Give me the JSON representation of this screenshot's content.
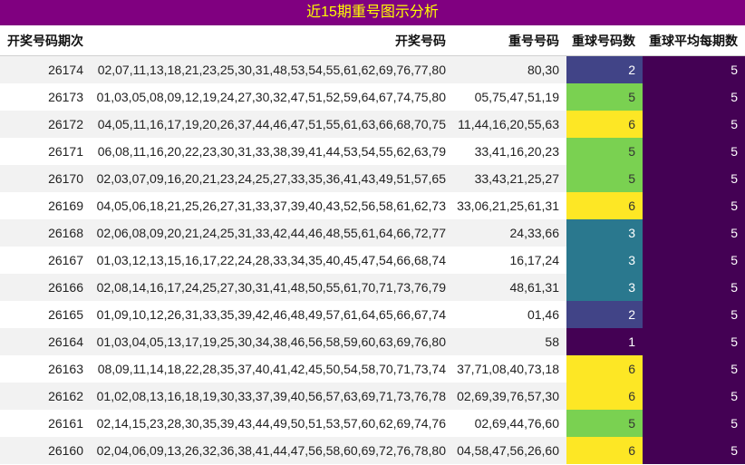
{
  "title": "近15期重号图示分析",
  "chart_data": {
    "type": "table",
    "title": "近15期重号图示分析",
    "columns": [
      "开奖号码期次",
      "开奖号码",
      "重号号码",
      "重球号码数",
      "重球平均每期数"
    ],
    "rows": [
      {
        "period": "26174",
        "numbers": "02,07,11,13,18,21,23,25,30,31,48,53,54,55,61,62,69,76,77,80",
        "repeats": "80,30",
        "repeat_count": 2,
        "avg": 5
      },
      {
        "period": "26173",
        "numbers": "01,03,05,08,09,12,19,24,27,30,32,47,51,52,59,64,67,74,75,80",
        "repeats": "05,75,47,51,19",
        "repeat_count": 5,
        "avg": 5
      },
      {
        "period": "26172",
        "numbers": "04,05,11,16,17,19,20,26,37,44,46,47,51,55,61,63,66,68,70,75",
        "repeats": "11,44,16,20,55,63",
        "repeat_count": 6,
        "avg": 5
      },
      {
        "period": "26171",
        "numbers": "06,08,11,16,20,22,23,30,31,33,38,39,41,44,53,54,55,62,63,79",
        "repeats": "33,41,16,20,23",
        "repeat_count": 5,
        "avg": 5
      },
      {
        "period": "26170",
        "numbers": "02,03,07,09,16,20,21,23,24,25,27,33,35,36,41,43,49,51,57,65",
        "repeats": "33,43,21,25,27",
        "repeat_count": 5,
        "avg": 5
      },
      {
        "period": "26169",
        "numbers": "04,05,06,18,21,25,26,27,31,33,37,39,40,43,52,56,58,61,62,73",
        "repeats": "33,06,21,25,61,31",
        "repeat_count": 6,
        "avg": 5
      },
      {
        "period": "26168",
        "numbers": "02,06,08,09,20,21,24,25,31,33,42,44,46,48,55,61,64,66,72,77",
        "repeats": "24,33,66",
        "repeat_count": 3,
        "avg": 5
      },
      {
        "period": "26167",
        "numbers": "01,03,12,13,15,16,17,22,24,28,33,34,35,40,45,47,54,66,68,74",
        "repeats": "16,17,24",
        "repeat_count": 3,
        "avg": 5
      },
      {
        "period": "26166",
        "numbers": "02,08,14,16,17,24,25,27,30,31,41,48,50,55,61,70,71,73,76,79",
        "repeats": "48,61,31",
        "repeat_count": 3,
        "avg": 5
      },
      {
        "period": "26165",
        "numbers": "01,09,10,12,26,31,33,35,39,42,46,48,49,57,61,64,65,66,67,74",
        "repeats": "01,46",
        "repeat_count": 2,
        "avg": 5
      },
      {
        "period": "26164",
        "numbers": "01,03,04,05,13,17,19,25,30,34,38,46,56,58,59,60,63,69,76,80",
        "repeats": "58",
        "repeat_count": 1,
        "avg": 5
      },
      {
        "period": "26163",
        "numbers": "08,09,11,14,18,22,28,35,37,40,41,42,45,50,54,58,70,71,73,74",
        "repeats": "37,71,08,40,73,18",
        "repeat_count": 6,
        "avg": 5
      },
      {
        "period": "26162",
        "numbers": "01,02,08,13,16,18,19,30,33,37,39,40,56,57,63,69,71,73,76,78",
        "repeats": "02,69,39,76,57,30",
        "repeat_count": 6,
        "avg": 5
      },
      {
        "period": "26161",
        "numbers": "02,14,15,23,28,30,35,39,43,44,49,50,51,53,57,60,62,69,74,76",
        "repeats": "02,69,44,76,60",
        "repeat_count": 5,
        "avg": 5
      },
      {
        "period": "26160",
        "numbers": "02,04,06,09,13,26,32,36,38,41,44,47,56,58,60,69,72,76,78,80",
        "repeats": "04,58,47,56,26,60",
        "repeat_count": 6,
        "avg": 5
      }
    ],
    "count_colors": {
      "1": "#440154",
      "2": "#414487",
      "3": "#2a788e",
      "5": "#7ad151",
      "6": "#fde725"
    },
    "avg_color": "#440154"
  }
}
